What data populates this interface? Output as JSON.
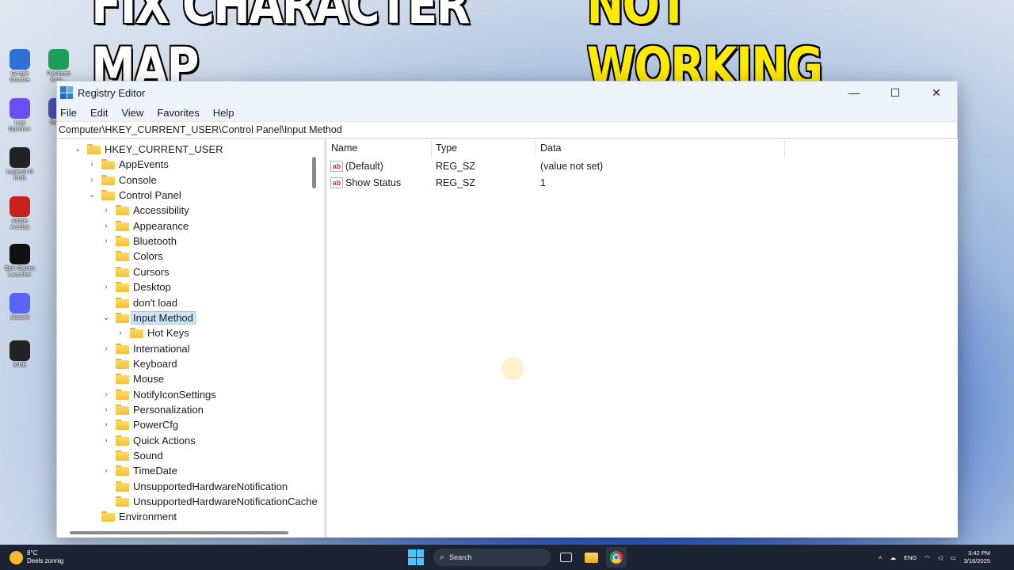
{
  "headline": {
    "part1": "FIX CHARACTER MAP",
    "part2": "NOT WORKING"
  },
  "desktop": {
    "icons": [
      {
        "label": "Google Chrome",
        "icon": "chrome-icon"
      },
      {
        "label": "Logi Options+",
        "icon": "logi-icon"
      },
      {
        "label": "Logitech G HUB",
        "icon": "ghub-icon"
      },
      {
        "label": "Adobe Acrobat",
        "icon": "acrobat-icon"
      },
      {
        "label": "Epic Games Launcher",
        "icon": "epic-icon"
      },
      {
        "label": "Discord",
        "icon": "discord-icon"
      },
      {
        "label": "iCUE",
        "icon": "icue-icon"
      }
    ],
    "second_column": [
      {
        "label": "PyCharm Com...",
        "icon": "pycharm-icon"
      },
      {
        "label": "Team...",
        "icon": "teams-icon"
      }
    ]
  },
  "window": {
    "title": "Registry Editor",
    "controls": {
      "minimize": "—",
      "maximize": "☐",
      "close": "✕"
    },
    "menu": [
      "File",
      "Edit",
      "View",
      "Favorites",
      "Help"
    ],
    "address": "Computer\\HKEY_CURRENT_USER\\Control Panel\\Input Method",
    "tree": [
      {
        "label": "HKEY_CURRENT_USER",
        "chevron": "⌄",
        "level": 0
      },
      {
        "label": "AppEvents",
        "chevron": "›",
        "level": 1
      },
      {
        "label": "Console",
        "chevron": "›",
        "level": 1
      },
      {
        "label": "Control Panel",
        "chevron": "⌄",
        "level": 1
      },
      {
        "label": "Accessibility",
        "chevron": "›",
        "level": 2
      },
      {
        "label": "Appearance",
        "chevron": "›",
        "level": 2
      },
      {
        "label": "Bluetooth",
        "chevron": "›",
        "level": 2
      },
      {
        "label": "Colors",
        "chevron": "",
        "level": 2
      },
      {
        "label": "Cursors",
        "chevron": "",
        "level": 2
      },
      {
        "label": "Desktop",
        "chevron": "›",
        "level": 2
      },
      {
        "label": "don't load",
        "chevron": "",
        "level": 2
      },
      {
        "label": "Input Method",
        "chevron": "⌄",
        "level": 2,
        "selected": true
      },
      {
        "label": "Hot Keys",
        "chevron": "›",
        "level": 3
      },
      {
        "label": "International",
        "chevron": "›",
        "level": 2
      },
      {
        "label": "Keyboard",
        "chevron": "",
        "level": 2
      },
      {
        "label": "Mouse",
        "chevron": "",
        "level": 2
      },
      {
        "label": "NotifyIconSettings",
        "chevron": "›",
        "level": 2
      },
      {
        "label": "Personalization",
        "chevron": "›",
        "level": 2
      },
      {
        "label": "PowerCfg",
        "chevron": "›",
        "level": 2
      },
      {
        "label": "Quick Actions",
        "chevron": "›",
        "level": 2
      },
      {
        "label": "Sound",
        "chevron": "",
        "level": 2
      },
      {
        "label": "TimeDate",
        "chevron": "›",
        "level": 2
      },
      {
        "label": "UnsupportedHardwareNotification",
        "chevron": "",
        "level": 2
      },
      {
        "label": "UnsupportedHardwareNotificationCache",
        "chevron": "",
        "level": 2
      },
      {
        "label": "Environment",
        "chevron": "",
        "level": 1
      }
    ],
    "columns": {
      "name": "Name",
      "type": "Type",
      "data": "Data"
    },
    "values": [
      {
        "name": "(Default)",
        "type": "REG_SZ",
        "data": "(value not set)",
        "icon": "ab"
      },
      {
        "name": "Show Status",
        "type": "REG_SZ",
        "data": "1",
        "icon": "ab"
      }
    ]
  },
  "taskbar": {
    "weather_temp": "8°C",
    "weather_desc": "Deels zonnig",
    "search_placeholder": "Search",
    "language": "ENG",
    "time": "3:42 PM",
    "date": "3/16/2025"
  }
}
